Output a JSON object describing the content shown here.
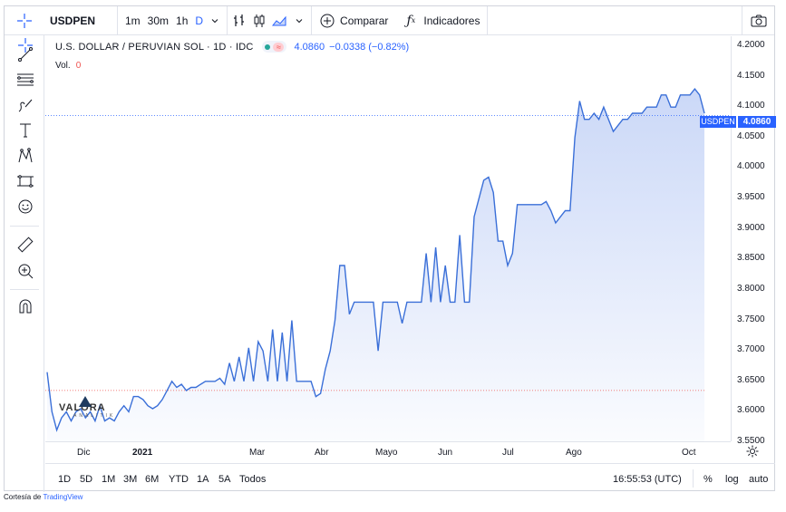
{
  "toolbar": {
    "symbol": "USDPEN",
    "intervals": [
      "1m",
      "30m",
      "1h",
      "D"
    ],
    "active_interval": "D",
    "compare_label": "Comparar",
    "indicators_label": "Indicadores",
    "icons": [
      "crosshair-icon",
      "chevron-down-icon",
      "bar-chart-icon",
      "candlestick-icon",
      "area-chart-icon",
      "chevron-down-icon",
      "plus-circle-icon",
      "fx-icon",
      "camera-icon"
    ]
  },
  "left_tools": [
    "crosshair-icon",
    "trend-line-icon",
    "horizontal-lines-icon",
    "brush-icon",
    "text-icon",
    "pattern-icon",
    "measure-tool-icon",
    "smiley-icon",
    "ruler-icon",
    "zoom-in-icon",
    "magnet-icon"
  ],
  "legend": {
    "title": "U.S. DOLLAR / PERUVIAN SOL · 1D · IDC",
    "last": "4.0860",
    "change": "−0.0338 (−0.82%)",
    "volume_label": "Vol.",
    "volume_value": "0"
  },
  "price_axis": [
    "4.2000",
    "4.1500",
    "4.1000",
    "4.0500",
    "4.0000",
    "3.9500",
    "3.9000",
    "3.8500",
    "3.8000",
    "3.7500",
    "3.7000",
    "3.6500",
    "3.6000",
    "3.5500"
  ],
  "price_badge": {
    "symbol": "USDPEN",
    "price": "4.0860"
  },
  "time_axis": [
    "Dic",
    "2021",
    "Mar",
    "Abr",
    "Mayo",
    "Jun",
    "Jul",
    "Ago",
    "Oct"
  ],
  "time_axis_bold": "2021",
  "bottom_bar": {
    "ranges": [
      "1D",
      "5D",
      "1M",
      "3M",
      "6M",
      "YTD",
      "1A",
      "5A",
      "Todos"
    ],
    "clock": "16:55:53 (UTC)",
    "percent": "%",
    "log": "log",
    "auto": "auto"
  },
  "watermark": {
    "name": "VALORA",
    "sub": "ANALITIK"
  },
  "credit": {
    "prefix": "Cortesía de ",
    "link": "TradingView"
  },
  "colors": {
    "line": "#3a6fd8",
    "accent": "#2962ff",
    "fill_top": "#c8d6f7",
    "down": "#ef5350"
  },
  "chart_data": {
    "type": "area",
    "symbol": "USDPEN",
    "ylim": [
      3.55,
      4.2
    ],
    "y_ticks": [
      3.55,
      3.6,
      3.65,
      3.7,
      3.75,
      3.8,
      3.85,
      3.9,
      3.95,
      4.0,
      4.05,
      4.1,
      4.15,
      4.2
    ],
    "x_labels": [
      "Dic",
      "2021",
      "Mar",
      "Abr",
      "Mayo",
      "Jun",
      "Jul",
      "Ago",
      "Oct"
    ],
    "values": [
      3.665,
      3.6,
      3.57,
      3.59,
      3.6,
      3.585,
      3.6,
      3.605,
      3.59,
      3.6,
      3.585,
      3.61,
      3.585,
      3.59,
      3.585,
      3.6,
      3.61,
      3.6,
      3.625,
      3.625,
      3.62,
      3.61,
      3.605,
      3.61,
      3.62,
      3.635,
      3.65,
      3.64,
      3.645,
      3.635,
      3.64,
      3.64,
      3.645,
      3.65,
      3.65,
      3.65,
      3.655,
      3.645,
      3.68,
      3.65,
      3.69,
      3.65,
      3.705,
      3.65,
      3.715,
      3.7,
      3.65,
      3.735,
      3.65,
      3.73,
      3.65,
      3.75,
      3.65,
      3.65,
      3.65,
      3.65,
      3.625,
      3.63,
      3.67,
      3.7,
      3.75,
      3.84,
      3.84,
      3.76,
      3.78,
      3.78,
      3.78,
      3.78,
      3.78,
      3.7,
      3.78,
      3.78,
      3.78,
      3.78,
      3.745,
      3.78,
      3.78,
      3.78,
      3.78,
      3.86,
      3.78,
      3.87,
      3.78,
      3.84,
      3.78,
      3.78,
      3.89,
      3.78,
      3.78,
      3.92,
      3.95,
      3.98,
      3.985,
      3.96,
      3.88,
      3.88,
      3.84,
      3.86,
      3.94,
      3.94,
      3.94,
      3.94,
      3.94,
      3.94,
      3.945,
      3.93,
      3.91,
      3.92,
      3.93,
      3.93,
      4.05,
      4.11,
      4.08,
      4.08,
      4.09,
      4.08,
      4.1,
      4.08,
      4.06,
      4.07,
      4.08,
      4.08,
      4.09,
      4.09,
      4.09,
      4.1,
      4.1,
      4.1,
      4.12,
      4.12,
      4.1,
      4.1,
      4.12,
      4.12,
      4.12,
      4.13,
      4.12,
      4.09
    ],
    "last_value": 4.086,
    "previous_close_line": 3.635
  }
}
